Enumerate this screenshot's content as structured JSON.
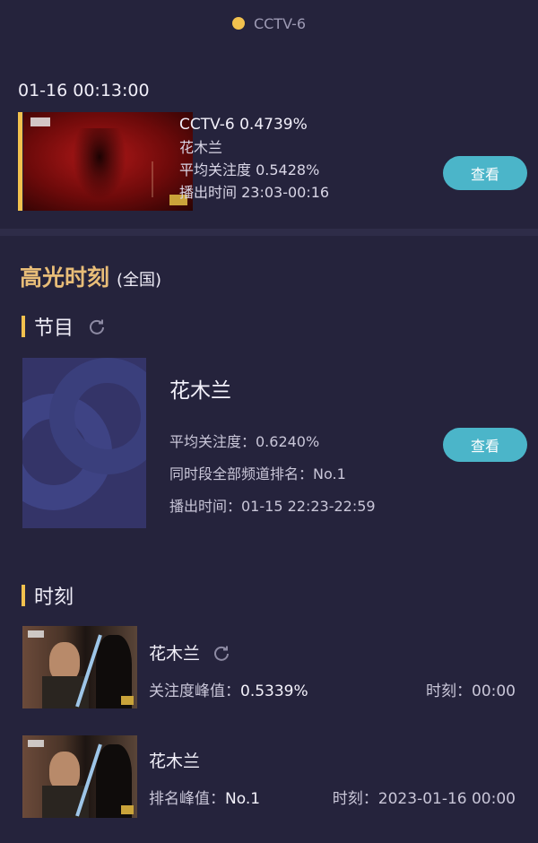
{
  "legend": {
    "label": "CCTV-6",
    "color": "#f2c14e"
  },
  "record": {
    "time": "01-16 00:13:00",
    "channel_share": "CCTV-6 0.4739%",
    "program": "花木兰",
    "avg_attention": "平均关注度 0.5428%",
    "air_time": "播出时间 23:03-00:16",
    "view_label": "查看"
  },
  "highlights": {
    "title": "高光时刻",
    "scope": "(全国)",
    "program_section": {
      "label": "节目",
      "title": "花木兰",
      "avg_attention": "平均关注度：0.6240%",
      "rank": "同时段全部频道排名：No.1",
      "air_time": "播出时间：01-15 22:23-22:59",
      "view_label": "查看"
    },
    "moment_section": {
      "label": "时刻",
      "items": [
        {
          "title": "花木兰",
          "metric_label": "关注度峰值：",
          "metric_value": "0.5339%",
          "time": "时刻：00:00"
        },
        {
          "title": "花木兰",
          "metric_label": "排名峰值：",
          "metric_value": "No.1",
          "time": "时刻：2023-01-16 00:00"
        }
      ]
    }
  },
  "icons": {
    "refresh": "refresh-icon",
    "legend_dot": "legend-dot-icon"
  },
  "colors": {
    "background": "#25233c",
    "accent_gold": "#f2c14e",
    "title_gold": "#e8bd78",
    "button": "#4bb5c9"
  }
}
